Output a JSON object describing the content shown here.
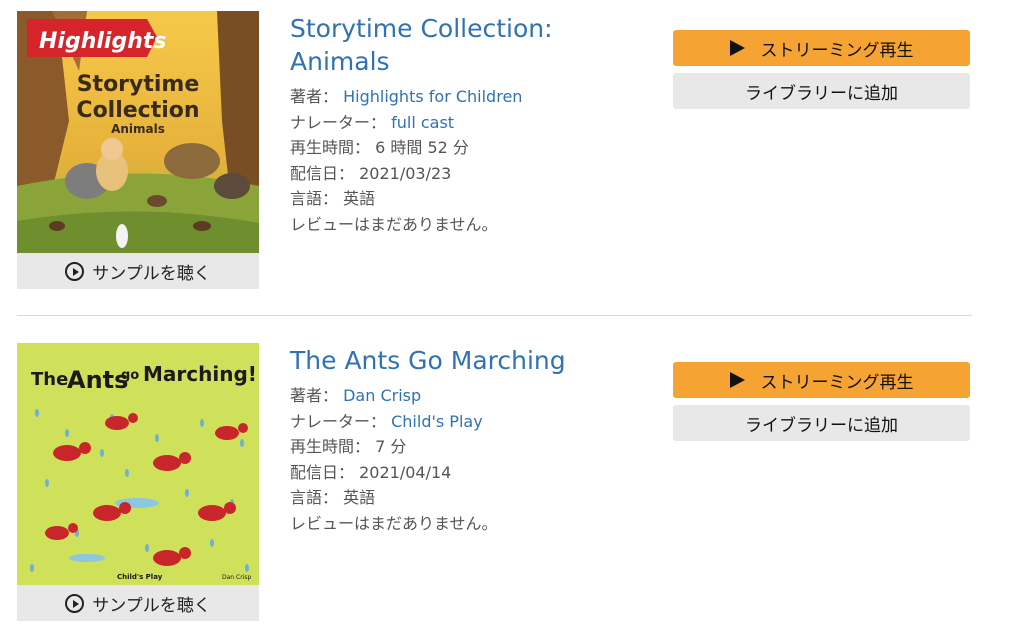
{
  "labels": {
    "author": "著者：",
    "narrator": "ナレーター：",
    "duration": "再生時間：",
    "release": "配信日：",
    "language": "言語：",
    "sample_button": "サンプルを聴く",
    "stream_button": "ストリーミング再生",
    "library_button": "ライブラリーに追加"
  },
  "items": [
    {
      "title_line1": "Storytime Collection:",
      "title_line2": "Animals",
      "author": "Highlights for Children",
      "narrator": "full cast",
      "duration": "6 時間 52 分",
      "release": "2021/03/23",
      "language": "英語",
      "reviews": "レビューはまだありません。",
      "cover": {
        "brand": "Highlights",
        "line1": "Storytime",
        "line2": "Collection",
        "line3": "Animals"
      }
    },
    {
      "title": "The Ants Go Marching",
      "author": "Dan Crisp",
      "narrator": "Child's Play",
      "duration": "7 分",
      "release": "2021/04/14",
      "language": "英語",
      "reviews": "レビューはまだありません。",
      "cover": {
        "title_the": "The",
        "title_ants": "Ants",
        "title_go": "go",
        "title_marching": "Marching!",
        "publisher": "Child's Play",
        "illustrator_credit": "Dan Crisp"
      }
    }
  ],
  "colors": {
    "link": "#2f72b5",
    "stream_button": "#f5a333",
    "secondary_button": "#e8e8e8",
    "divider": "#d8d8d8"
  }
}
